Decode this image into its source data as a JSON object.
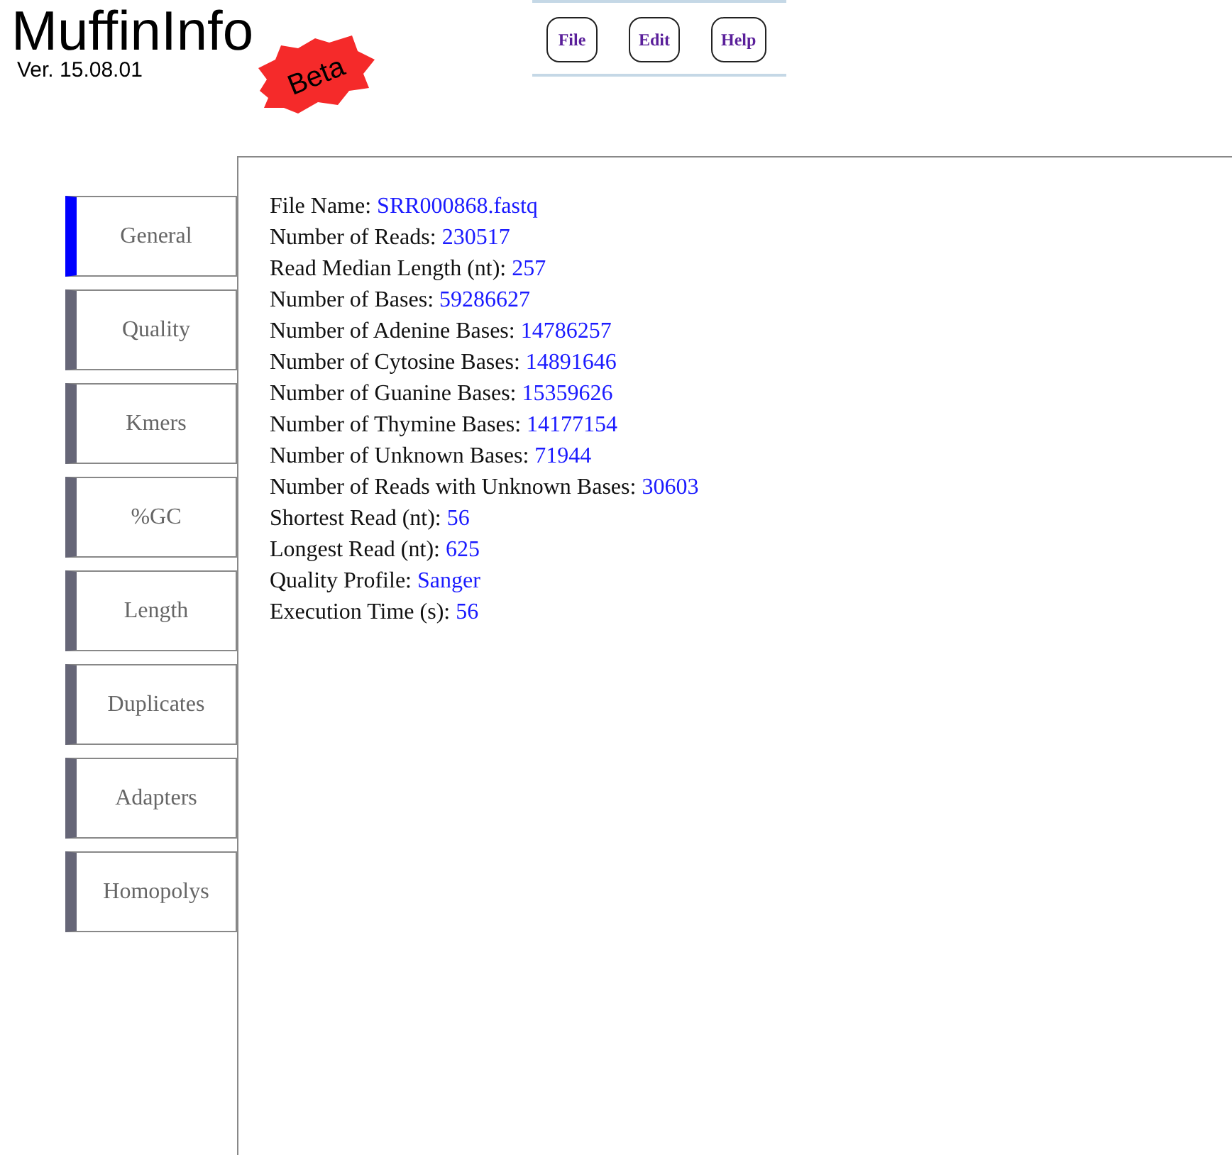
{
  "app": {
    "title": "MuffinInfo",
    "version": "Ver. 15.08.01",
    "badge": "Beta"
  },
  "menu": [
    "File",
    "Edit",
    "Help"
  ],
  "tabs": [
    {
      "label": "General",
      "selected": true
    },
    {
      "label": "Quality",
      "selected": false
    },
    {
      "label": "Kmers",
      "selected": false
    },
    {
      "label": "%GC",
      "selected": false
    },
    {
      "label": "Length",
      "selected": false
    },
    {
      "label": "Duplicates",
      "selected": false
    },
    {
      "label": "Adapters",
      "selected": false
    },
    {
      "label": "Homopolys",
      "selected": false
    }
  ],
  "info": [
    {
      "label": "File Name:",
      "value": "SRR000868.fastq"
    },
    {
      "label": "Number of Reads:",
      "value": "230517"
    },
    {
      "label": "Read Median Length (nt):",
      "value": "257"
    },
    {
      "label": "Number of Bases:",
      "value": "59286627"
    },
    {
      "label": "Number of Adenine Bases:",
      "value": "14786257"
    },
    {
      "label": "Number of Cytosine Bases:",
      "value": "14891646"
    },
    {
      "label": "Number of Guanine Bases:",
      "value": "15359626"
    },
    {
      "label": "Number of Thymine Bases:",
      "value": "14177154"
    },
    {
      "label": "Number of Unknown Bases:",
      "value": "71944"
    },
    {
      "label": "Number of Reads with Unknown Bases:",
      "value": "30603"
    },
    {
      "label": "Shortest Read (nt):",
      "value": "56"
    },
    {
      "label": "Longest Read (nt):",
      "value": "625"
    },
    {
      "label": "Quality Profile:",
      "value": "Sanger"
    },
    {
      "label": "Execution Time (s):",
      "value": "56"
    }
  ]
}
